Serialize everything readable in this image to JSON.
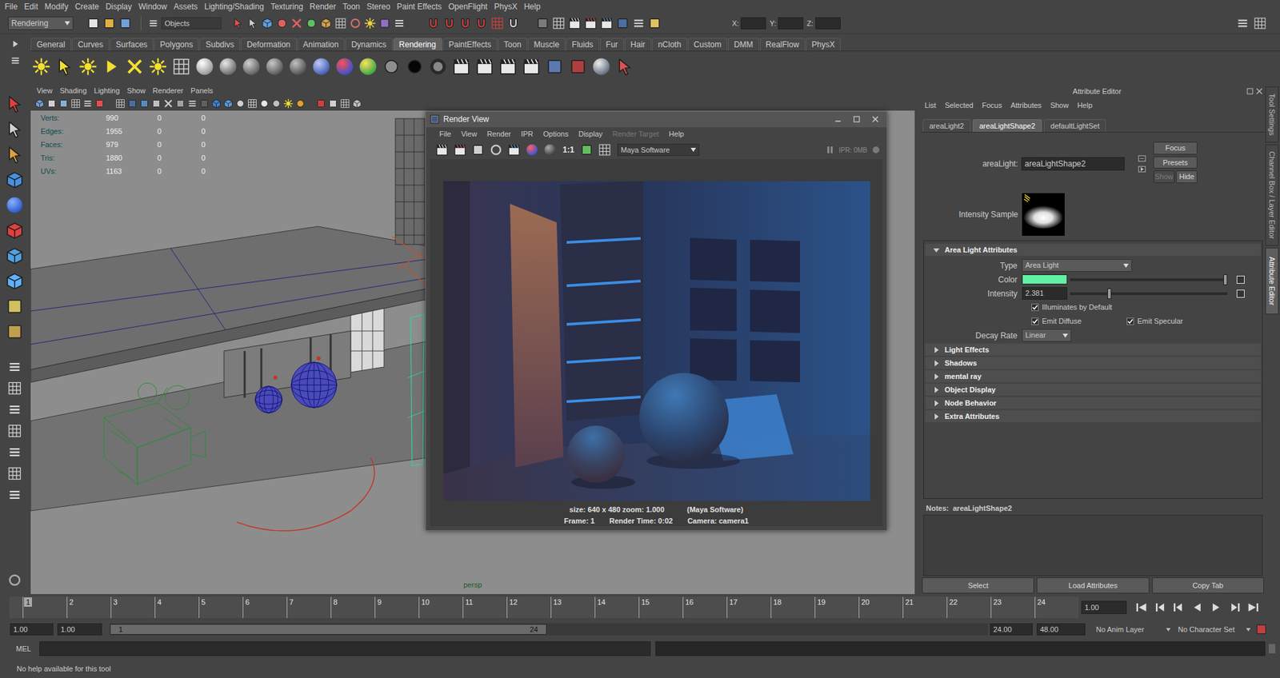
{
  "menu_bar": [
    "File",
    "Edit",
    "Modify",
    "Create",
    "Display",
    "Window",
    "Assets",
    "Lighting/Shading",
    "Texturing",
    "Render",
    "Toon",
    "Stereo",
    "Paint Effects",
    "OpenFlight",
    "PhysX",
    "Help"
  ],
  "status_line": {
    "menu_set": "Rendering",
    "selection_mode": "Objects",
    "coordinate_labels": [
      "X:",
      "Y:",
      "Z:"
    ]
  },
  "shelf_tabs": [
    {
      "label": "General",
      "selected": false
    },
    {
      "label": "Curves",
      "selected": false
    },
    {
      "label": "Surfaces",
      "selected": false
    },
    {
      "label": "Polygons",
      "selected": false
    },
    {
      "label": "Subdivs",
      "selected": false
    },
    {
      "label": "Deformation",
      "selected": false
    },
    {
      "label": "Animation",
      "selected": false
    },
    {
      "label": "Dynamics",
      "selected": false
    },
    {
      "label": "Rendering",
      "selected": true
    },
    {
      "label": "PaintEffects",
      "selected": false
    },
    {
      "label": "Toon",
      "selected": false
    },
    {
      "label": "Muscle",
      "selected": false
    },
    {
      "label": "Fluids",
      "selected": false
    },
    {
      "label": "Fur",
      "selected": false
    },
    {
      "label": "Hair",
      "selected": false
    },
    {
      "label": "nCloth",
      "selected": false
    },
    {
      "label": "Custom",
      "selected": false
    },
    {
      "label": "DMM",
      "selected": false
    },
    {
      "label": "RealFlow",
      "selected": false
    },
    {
      "label": "PhysX",
      "selected": false
    }
  ],
  "viewport": {
    "menu": [
      "View",
      "Shading",
      "Lighting",
      "Show",
      "Renderer",
      "Panels"
    ],
    "hud": [
      {
        "label": "Verts:",
        "values": [
          "990",
          "0",
          "0"
        ]
      },
      {
        "label": "Edges:",
        "values": [
          "1955",
          "0",
          "0"
        ]
      },
      {
        "label": "Faces:",
        "values": [
          "979",
          "0",
          "0"
        ]
      },
      {
        "label": "Tris:",
        "values": [
          "1880",
          "0",
          "0"
        ]
      },
      {
        "label": "UVs:",
        "values": [
          "1163",
          "0",
          "0"
        ]
      }
    ],
    "camera": "persp"
  },
  "render_view": {
    "title": "Render View",
    "menu": [
      {
        "label": "File",
        "disabled": false
      },
      {
        "label": "View",
        "disabled": false
      },
      {
        "label": "Render",
        "disabled": false
      },
      {
        "label": "IPR",
        "disabled": false
      },
      {
        "label": "Options",
        "disabled": false
      },
      {
        "label": "Display",
        "disabled": false
      },
      {
        "label": "Render Target",
        "disabled": true
      },
      {
        "label": "Help",
        "disabled": false
      }
    ],
    "zoom": "1:1",
    "renderer": "Maya Software",
    "ipr_memory": "IPR: 0MB",
    "info": {
      "size": "size: 640 x 480 zoom: 1.000",
      "renderer": "(Maya Software)",
      "frame": "Frame: 1",
      "render_time": "Render Time: 0:02",
      "camera": "Camera: camera1"
    }
  },
  "attribute_editor": {
    "title": "Attribute Editor",
    "menu": [
      "List",
      "Selected",
      "Focus",
      "Attributes",
      "Show",
      "Help"
    ],
    "tabs": [
      {
        "label": "areaLight2",
        "selected": false
      },
      {
        "label": "areaLightShape2",
        "selected": true
      },
      {
        "label": "defaultLightSet",
        "selected": false
      }
    ],
    "node_label": "areaLight:",
    "node_name": "areaLightShape2",
    "buttons": [
      {
        "label": "Focus",
        "disabled": false
      },
      {
        "label": "Presets",
        "disabled": false
      },
      {
        "label": "Show",
        "disabled": true
      },
      {
        "label": "Hide",
        "disabled": false
      }
    ],
    "sample_label": "Intensity Sample",
    "sections": [
      {
        "title": "Area Light Attributes",
        "expanded": true
      },
      {
        "title": "Light Effects",
        "expanded": false
      },
      {
        "title": "Shadows",
        "expanded": false
      },
      {
        "title": "mental ray",
        "expanded": false
      },
      {
        "title": "Object Display",
        "expanded": false
      },
      {
        "title": "Node Behavior",
        "expanded": false
      },
      {
        "title": "Extra Attributes",
        "expanded": false
      }
    ],
    "area_light": {
      "type_label": "Type",
      "type_value": "Area Light",
      "color_label": "Color",
      "color_swatch": "#62f0a4",
      "color_level": 1.0,
      "intensity_label": "Intensity",
      "intensity": "2.381",
      "intensity_level": 0.25,
      "checks": [
        {
          "label": "Illuminates by Default",
          "checked": true
        },
        {
          "label": "Emit Diffuse",
          "checked": true
        },
        {
          "label": "Emit Specular",
          "checked": true
        }
      ],
      "decay_label": "Decay Rate",
      "decay_value": "Linear"
    },
    "notes_label": "Notes:",
    "notes_node": "areaLightShape2",
    "bottom_buttons": [
      "Select",
      "Load Attributes",
      "Copy Tab"
    ]
  },
  "side_tabs": [
    {
      "label": "Tool Settings",
      "selected": false
    },
    {
      "label": "Channel Box / Layer Editor",
      "selected": false
    },
    {
      "label": "Attribute Editor",
      "selected": true
    }
  ],
  "time_slider": {
    "ticks": [
      {
        "label": "1",
        "selected": true
      },
      {
        "label": "2",
        "selected": false
      },
      {
        "label": "3",
        "selected": false
      },
      {
        "label": "4",
        "selected": false
      },
      {
        "label": "5",
        "selected": false
      },
      {
        "label": "6",
        "selected": false
      },
      {
        "label": "7",
        "selected": false
      },
      {
        "label": "8",
        "selected": false
      },
      {
        "label": "9",
        "selected": false
      },
      {
        "label": "10",
        "selected": false
      },
      {
        "label": "11",
        "selected": false
      },
      {
        "label": "12",
        "selected": false
      },
      {
        "label": "13",
        "selected": false
      },
      {
        "label": "14",
        "selected": false
      },
      {
        "label": "15",
        "selected": false
      },
      {
        "label": "16",
        "selected": false
      },
      {
        "label": "17",
        "selected": false
      },
      {
        "label": "18",
        "selected": false
      },
      {
        "label": "19",
        "selected": false
      },
      {
        "label": "20",
        "selected": false
      },
      {
        "label": "21",
        "selected": false
      },
      {
        "label": "22",
        "selected": false
      },
      {
        "label": "23",
        "selected": false
      },
      {
        "label": "24",
        "selected": false
      }
    ],
    "current_frame": "1.00"
  },
  "range_slider": {
    "start_time": "1.00",
    "playback_start": "1.00",
    "bar_start": "1",
    "bar_end": "24",
    "playback_end": "24.00",
    "end_time": "48.00",
    "anim_layer": "No Anim Layer",
    "character_set": "No Character Set"
  },
  "command_line": {
    "language": "MEL"
  },
  "help_line": "No help available for this tool"
}
